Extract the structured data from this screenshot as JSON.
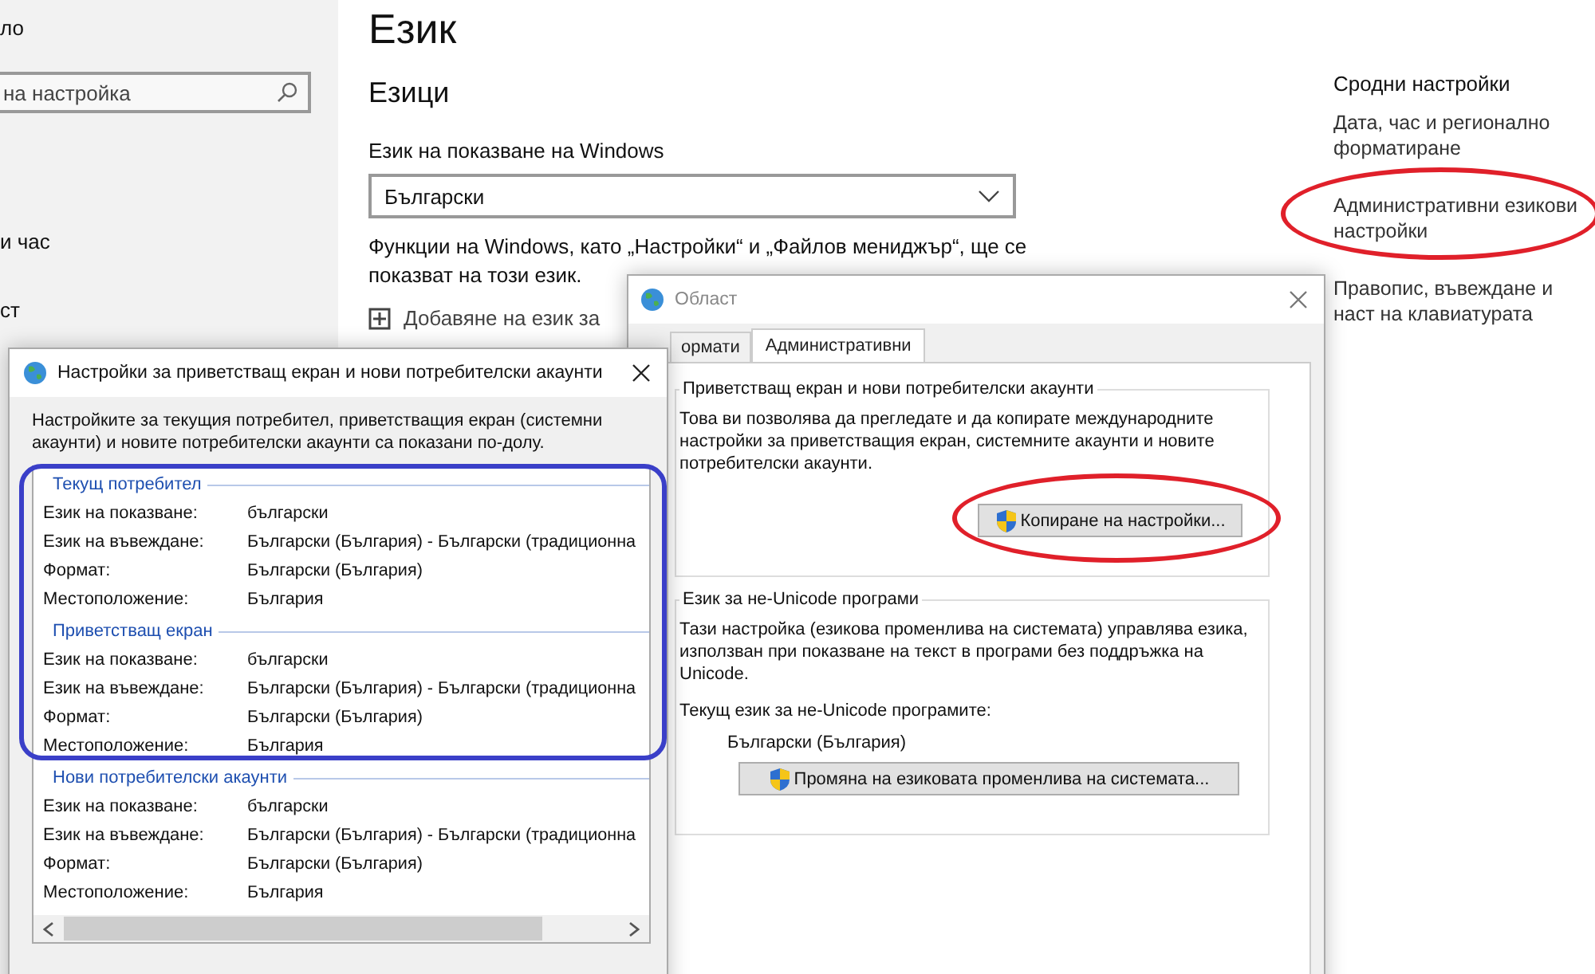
{
  "settings": {
    "sidebar": {
      "top_item": "ло",
      "search": {
        "placeholder": "на настройка"
      },
      "items": [
        "и час",
        "ст"
      ]
    },
    "title": "Език",
    "section": "Езици",
    "display_language": {
      "label": "Език на показване на Windows",
      "value": "Български"
    },
    "note": "Функции на Windows, като „Настройки“ и „Файлов мениджър“, ще се показват на този език.",
    "add_language": "Добавяне на език за",
    "related": {
      "title": "Сродни настройки",
      "links": [
        "Дата, час и регионално форматиране",
        "Административни езикови настройки",
        "Правопис, въвеждане и наст на клавиатурата"
      ]
    }
  },
  "region_dialog": {
    "title": "Област",
    "active": false,
    "tabs": [
      {
        "label": "ормати",
        "selected": false
      },
      {
        "label": "Административни",
        "selected": true
      }
    ],
    "welcome_group": {
      "title": "Приветстващ екран и нови потребителски акаунти",
      "text": "Това ви позволява да прегледате и да копирате международните настройки за приветстващия екран, системните акаунти и новите потребителски акаунти.",
      "button": "Копиране на настройки..."
    },
    "unicode_group": {
      "title": "Език за не-Unicode програми",
      "text": "Тази настройка (езикова променлива на системата) управлява езика, използван при показване на текст в програми без поддръжка на Unicode.",
      "current_label": "Текущ език за не-Unicode програмите:",
      "current_value": "Български (България)",
      "button": "Промяна на езиковата променлива на системата..."
    }
  },
  "welcome_dialog": {
    "title": "Настройки за приветстващ екран и нови потребителски акаунти",
    "active": true,
    "intro": "Настройките за текущия потребител, приветстващия екран (системни акаунти) и новите потребителски акаунти са показани по-долу.",
    "sections": [
      {
        "title": "Текущ потребител",
        "rows": [
          {
            "label": "Език на показване:",
            "value": "български"
          },
          {
            "label": "Език на въвеждане:",
            "value": "Български (България) - Български (традиционна"
          },
          {
            "label": "Формат:",
            "value": "Български (България)"
          },
          {
            "label": "Местоположение:",
            "value": "България"
          }
        ]
      },
      {
        "title": "Приветстващ екран",
        "rows": [
          {
            "label": "Език на показване:",
            "value": "български"
          },
          {
            "label": "Език на въвеждане:",
            "value": "Български (България) - Български (традиционна"
          },
          {
            "label": "Формат:",
            "value": "Български (България)"
          },
          {
            "label": "Местоположение:",
            "value": "България"
          }
        ]
      },
      {
        "title": "Нови потребителски акаунти",
        "rows": [
          {
            "label": "Език на показване:",
            "value": "български"
          },
          {
            "label": "Език на въвеждане:",
            "value": "Български (България) - Български (традиционна"
          },
          {
            "label": "Формат:",
            "value": "Български (България)"
          },
          {
            "label": "Местоположение:",
            "value": "България"
          }
        ]
      }
    ]
  },
  "annotations": [
    {
      "kind": "ellipse",
      "color": "#e0202a"
    },
    {
      "kind": "ellipse",
      "color": "#e0202a"
    },
    {
      "kind": "rect",
      "color": "#3a3fc8"
    }
  ]
}
